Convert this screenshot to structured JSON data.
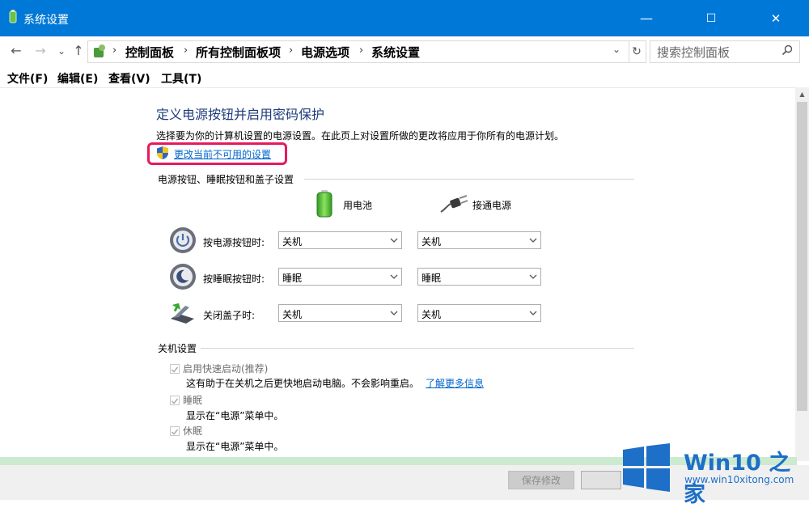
{
  "window": {
    "title": "系统设置",
    "controls": {
      "minimize": "—",
      "maximize": "☐",
      "close": "✕"
    }
  },
  "nav": {
    "back": "←",
    "forward": "→",
    "recent": "⌄",
    "up": "↑",
    "breadcrumbs": [
      "控制面板",
      "所有控制面板项",
      "电源选项",
      "系统设置"
    ],
    "separator": "›",
    "dropdown": "⌄",
    "refresh": "↻",
    "search_placeholder": "搜索控制面板"
  },
  "menu": [
    "文件(F)",
    "编辑(E)",
    "查看(V)",
    "工具(T)"
  ],
  "content": {
    "heading": "定义电源按钮并启用密码保护",
    "description": "选择要为你的计算机设置的电源设置。在此页上对设置所做的更改将应用于你所有的电源计划。",
    "change_link": "更改当前不可用的设置",
    "section1": "电源按钮、睡眠按钮和盖子设置",
    "col_battery": "用电池",
    "col_plugged": "接通电源",
    "rows": [
      {
        "label": "按电源按钮时:",
        "battery": "关机",
        "plugged": "关机"
      },
      {
        "label": "按睡眠按钮时:",
        "battery": "睡眠",
        "plugged": "睡眠"
      },
      {
        "label": "关闭盖子时:",
        "battery": "关机",
        "plugged": "关机"
      }
    ],
    "section2": "关机设置",
    "shutdown_options": [
      {
        "label": "启用快速启动(推荐)",
        "desc": "这有助于在关机之后更快地启动电脑。不会影响重启。",
        "checked": true
      },
      {
        "label": "睡眠",
        "desc": "显示在“电源”菜单中。",
        "checked": true
      },
      {
        "label": "休眠",
        "desc": "显示在“电源”菜单中。",
        "checked": true
      }
    ],
    "learn_more": "了解更多信息"
  },
  "footer": {
    "save": "保存修改"
  },
  "watermark": {
    "title": "Win10 之家",
    "url": "www.win10xitong.com"
  },
  "colors": {
    "titlebar": "#0078d7",
    "heading": "#1e3c7c",
    "link": "#0066cc",
    "highlight": "#e8195c",
    "watermark": "#1d6fc7"
  }
}
